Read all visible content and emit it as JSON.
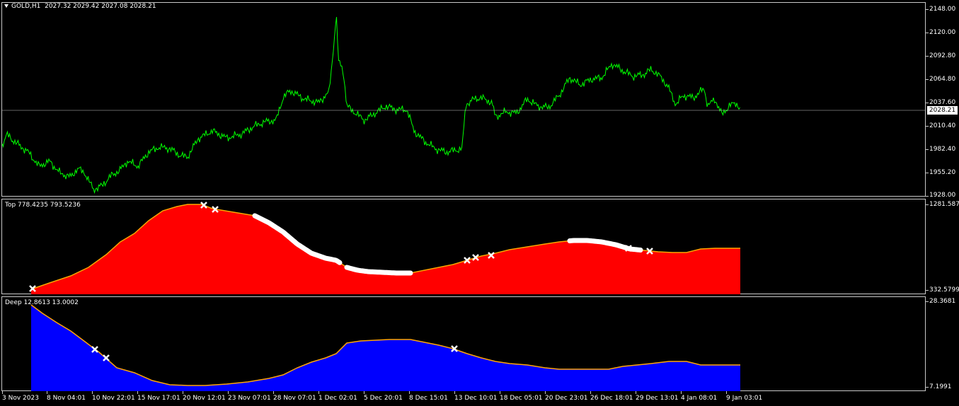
{
  "main": {
    "symbol": "GOLD,H1",
    "ohlc": "2027.32 2029.42 2027.08 2028.21",
    "current_price": "2028.21",
    "price_ticks": [
      "2148.00",
      "2120.00",
      "2092.80",
      "2064.80",
      "2037.60",
      "2010.40",
      "1982.40",
      "1955.20",
      "1928.00"
    ],
    "line_color": "#00ff00"
  },
  "top_indicator": {
    "label": "Top 778.4235 793.5236",
    "max_label": "1281.587",
    "min_label": "332.5799",
    "fill_color": "#ff0000",
    "line_color": "#ffa500",
    "marker_color": "#ffffff"
  },
  "deep_indicator": {
    "label": "Deep 12.8613 13.0002",
    "max_label": "28.3681",
    "min_label": "7.1991",
    "fill_color": "#0000ff",
    "line_color": "#ffa500",
    "marker_color": "#ffffff"
  },
  "time_axis": {
    "labels": [
      "3 Nov 2023",
      "8 Nov 04:01",
      "10 Nov 22:01",
      "15 Nov 17:01",
      "20 Nov 12:01",
      "23 Nov 07:01",
      "28 Nov 07:01",
      "1 Dec 02:01",
      "5 Dec 20:01",
      "8 Dec 15:01",
      "13 Dec 10:01",
      "18 Dec 05:01",
      "20 Dec 23:01",
      "26 Dec 18:01",
      "29 Dec 13:01",
      "4 Jan 08:01",
      "9 Jan 03:01"
    ]
  }
}
